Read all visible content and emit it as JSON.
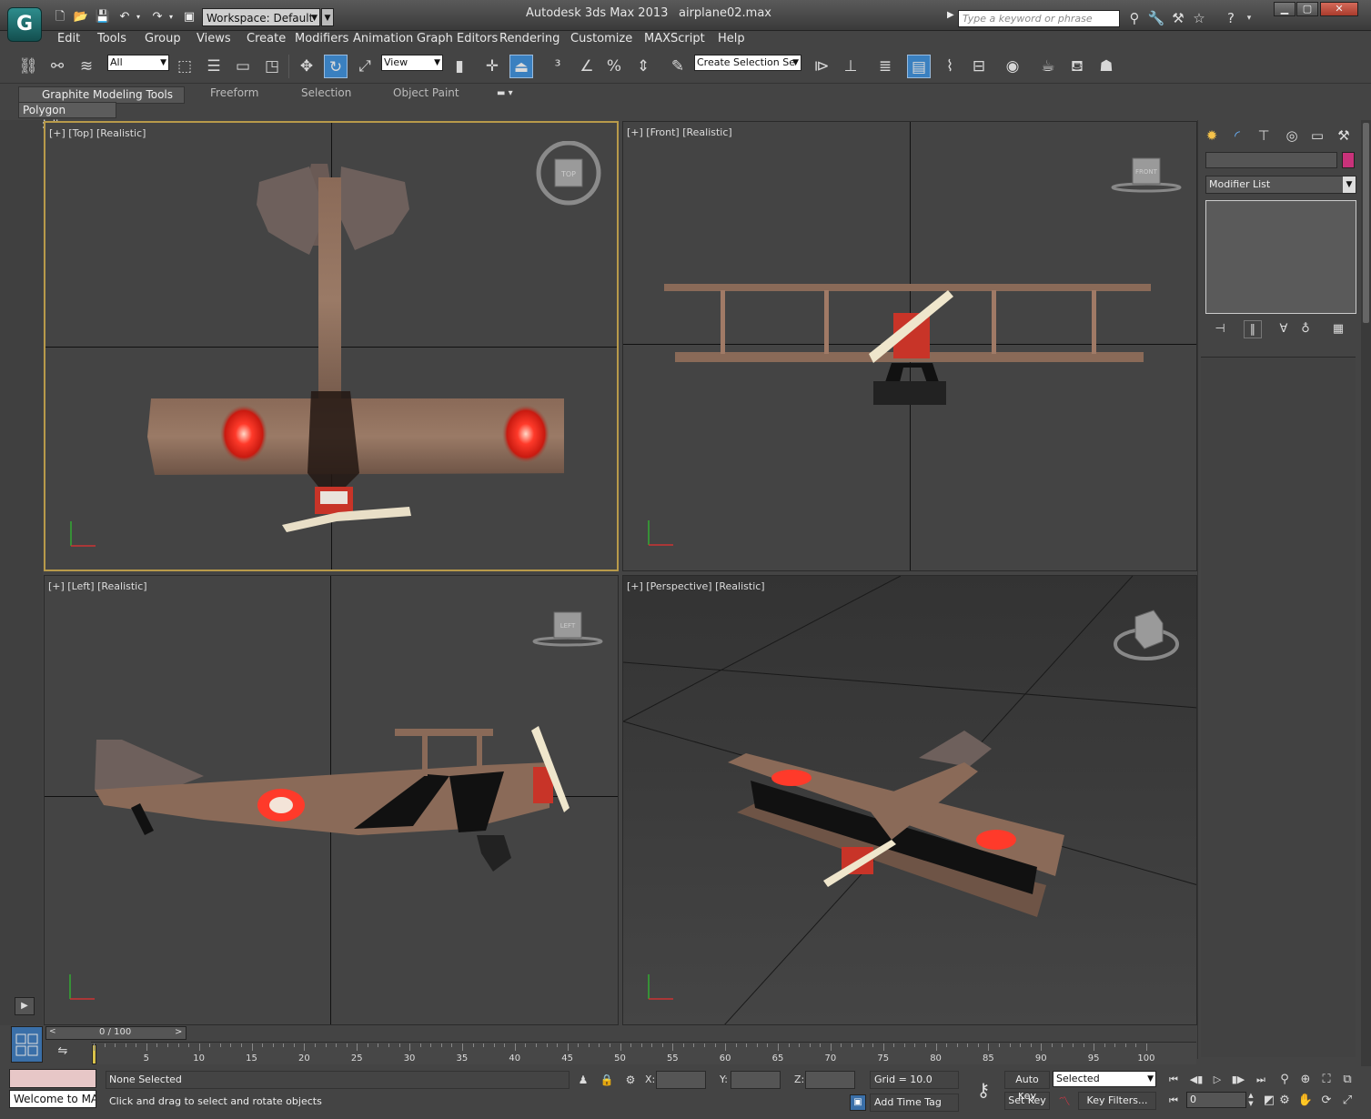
{
  "title_bar": {
    "workspace_label": "Workspace: Default",
    "app_title": "Autodesk 3ds Max  2013",
    "file_name": "airplane02.max",
    "search_placeholder": "Type a keyword or phrase"
  },
  "menu": [
    "Edit",
    "Tools",
    "Group",
    "Views",
    "Create",
    "Modifiers",
    "Animation",
    "Graph Editors",
    "Rendering",
    "Customize",
    "MAXScript",
    "Help"
  ],
  "toolbar": {
    "selection_filter": "All",
    "reference_coord": "View",
    "named_selection_placeholder": "Create Selection Se"
  },
  "ribbon": {
    "tabs": [
      "Graphite Modeling Tools",
      "Freeform",
      "Selection",
      "Object Paint"
    ],
    "panel_label": "Polygon Modeling"
  },
  "viewports": {
    "top": {
      "label": "[+] [Top] [Realistic]",
      "cube": "TOP"
    },
    "front": {
      "label": "[+] [Front] [Realistic]",
      "cube": "FRONT"
    },
    "left": {
      "label": "[+] [Left] [Realistic]",
      "cube": "LEFT"
    },
    "perspective": {
      "label": "[+] [Perspective] [Realistic]"
    }
  },
  "command_panel": {
    "modifier_list": "Modifier List",
    "object_color": "#c8327a"
  },
  "time": {
    "slider_label": "0 / 100",
    "ticks": [
      "5",
      "10",
      "15",
      "20",
      "25",
      "30",
      "35",
      "40",
      "45",
      "50",
      "55",
      "60",
      "65",
      "70",
      "75",
      "80",
      "85",
      "90",
      "95",
      "100"
    ]
  },
  "status": {
    "welcome": "Welcome to MA",
    "selection": "None Selected",
    "prompt": "Click and drag to select and rotate objects",
    "x_label": "X:",
    "y_label": "Y:",
    "z_label": "Z:",
    "grid": "Grid = 10.0",
    "add_time_tag": "Add Time Tag",
    "auto_key": "Auto Key",
    "set_key": "Set Key",
    "key_mode": "Selected",
    "key_filters": "Key Filters...",
    "current_frame": "0"
  }
}
